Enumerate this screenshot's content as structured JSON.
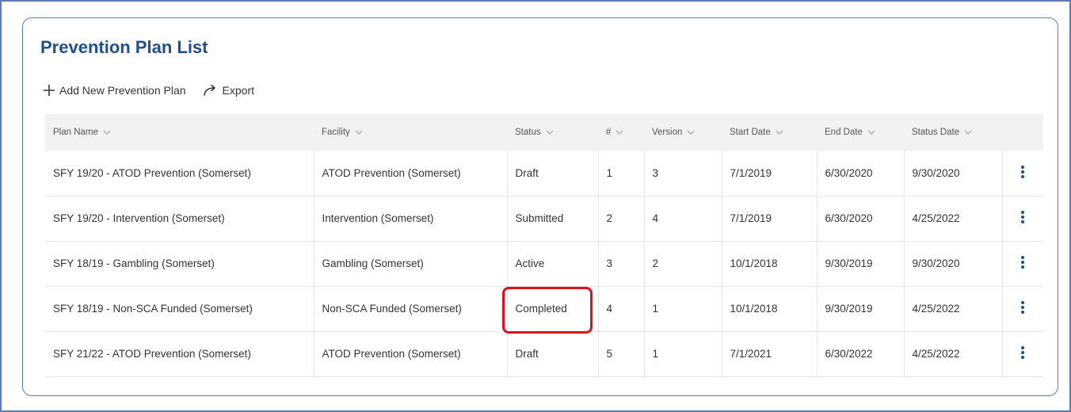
{
  "page": {
    "title": "Prevention Plan List"
  },
  "toolbar": {
    "add_label": "Add New Prevention Plan",
    "add_icon": "plus-icon",
    "export_label": "Export",
    "export_icon": "share-arrow-icon"
  },
  "table": {
    "columns": [
      {
        "label": "Plan Name"
      },
      {
        "label": "Facility"
      },
      {
        "label": "Status"
      },
      {
        "label": "#"
      },
      {
        "label": "Version"
      },
      {
        "label": "Start Date"
      },
      {
        "label": "End Date"
      },
      {
        "label": "Status Date"
      }
    ],
    "rows": [
      {
        "plan_name": "SFY 19/20 - ATOD Prevention (Somerset)",
        "facility": "ATOD Prevention (Somerset)",
        "status": "Draft",
        "num": "1",
        "version": "3",
        "start_date": "7/1/2019",
        "end_date": "6/30/2020",
        "status_date": "9/30/2020"
      },
      {
        "plan_name": "SFY 19/20 - Intervention (Somerset)",
        "facility": "Intervention (Somerset)",
        "status": "Submitted",
        "num": "2",
        "version": "4",
        "start_date": "7/1/2019",
        "end_date": "6/30/2020",
        "status_date": "4/25/2022"
      },
      {
        "plan_name": "SFY 18/19 - Gambling (Somerset)",
        "facility": "Gambling (Somerset)",
        "status": "Active",
        "num": "3",
        "version": "2",
        "start_date": "10/1/2018",
        "end_date": "9/30/2019",
        "status_date": "9/30/2020"
      },
      {
        "plan_name": "SFY 18/19 - Non-SCA Funded (Somerset)",
        "facility": "Non-SCA Funded (Somerset)",
        "status": "Completed",
        "num": "4",
        "version": "1",
        "start_date": "10/1/2018",
        "end_date": "9/30/2019",
        "status_date": "4/25/2022"
      },
      {
        "plan_name": "SFY 21/22 - ATOD Prevention (Somerset)",
        "facility": "ATOD Prevention (Somerset)",
        "status": "Draft",
        "num": "5",
        "version": "1",
        "start_date": "7/1/2021",
        "end_date": "6/30/2022",
        "status_date": "4/25/2022"
      }
    ],
    "row_menu_icon": "kebab-menu-icon",
    "sort_icon": "chevron-down-icon"
  },
  "colors": {
    "title": "#1f4f91",
    "border": "#5b7db1",
    "header_bg": "#f2f2f2",
    "kebab": "#1f4f91",
    "highlight": "#e0101b"
  }
}
